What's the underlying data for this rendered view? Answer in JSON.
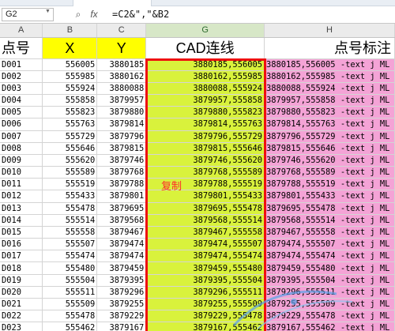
{
  "formula_bar": {
    "cell_ref": "G2",
    "fx_icon": "fx-icon",
    "formula": "=C2&\",\"&B2"
  },
  "columns": [
    "A",
    "B",
    "C",
    "G",
    "H"
  ],
  "headers": {
    "a": "点号",
    "b": "X",
    "c": "Y",
    "g": "CAD连线",
    "h": "点号标注"
  },
  "rows": [
    {
      "a": "D001",
      "b": "556005",
      "c": "3880185",
      "g": "3880185,556005",
      "h": "3880185,556005  -text j ML"
    },
    {
      "a": "D002",
      "b": "555985",
      "c": "3880162",
      "g": "3880162,555985",
      "h": "3880162,555985  -text j ML"
    },
    {
      "a": "D003",
      "b": "555924",
      "c": "3880088",
      "g": "3880088,555924",
      "h": "3880088,555924  -text j ML"
    },
    {
      "a": "D004",
      "b": "555858",
      "c": "3879957",
      "g": "3879957,555858",
      "h": "3879957,555858  -text j ML"
    },
    {
      "a": "D005",
      "b": "555823",
      "c": "3879880",
      "g": "3879880,555823",
      "h": "3879880,555823  -text j ML"
    },
    {
      "a": "D006",
      "b": "555763",
      "c": "3879814",
      "g": "3879814,555763",
      "h": "3879814,555763  -text j ML"
    },
    {
      "a": "D007",
      "b": "555729",
      "c": "3879796",
      "g": "3879796,555729",
      "h": "3879796,555729  -text j ML"
    },
    {
      "a": "D008",
      "b": "555646",
      "c": "3879815",
      "g": "3879815,555646",
      "h": "3879815,555646  -text j ML"
    },
    {
      "a": "D009",
      "b": "555620",
      "c": "3879746",
      "g": "3879746,555620",
      "h": "3879746,555620  -text j ML"
    },
    {
      "a": "D010",
      "b": "555589",
      "c": "3879768",
      "g": "3879768,555589",
      "h": "3879768,555589  -text j ML"
    },
    {
      "a": "D011",
      "b": "555519",
      "c": "3879788",
      "g": "3879788,555519",
      "h": "3879788,555519  -text j ML"
    },
    {
      "a": "D012",
      "b": "555433",
      "c": "3879801",
      "g": "3879801,555433",
      "h": "3879801,555433  -text j ML"
    },
    {
      "a": "D013",
      "b": "555478",
      "c": "3879695",
      "g": "3879695,555478",
      "h": "3879695,555478  -text j ML"
    },
    {
      "a": "D014",
      "b": "555514",
      "c": "3879568",
      "g": "3879568,555514",
      "h": "3879568,555514  -text j ML"
    },
    {
      "a": "D015",
      "b": "555558",
      "c": "3879467",
      "g": "3879467,555558",
      "h": "3879467,555558  -text j ML"
    },
    {
      "a": "D016",
      "b": "555507",
      "c": "3879474",
      "g": "3879474,555507",
      "h": "3879474,555507  -text j ML"
    },
    {
      "a": "D017",
      "b": "555474",
      "c": "3879474",
      "g": "3879474,555474",
      "h": "3879474,555474  -text j ML"
    },
    {
      "a": "D018",
      "b": "555480",
      "c": "3879459",
      "g": "3879459,555480",
      "h": "3879459,555480  -text j ML"
    },
    {
      "a": "D019",
      "b": "555504",
      "c": "3879395",
      "g": "3879395,555504",
      "h": "3879395,555504  -text j ML"
    },
    {
      "a": "D020",
      "b": "555511",
      "c": "3879296",
      "g": "3879296,555511",
      "h": "3879296,555511  -text j ML"
    },
    {
      "a": "D021",
      "b": "555509",
      "c": "3879255",
      "g": "3879255,555509",
      "h": "3879255,555509  -text j ML"
    },
    {
      "a": "D022",
      "b": "555478",
      "c": "3879229",
      "g": "3879229,555478",
      "h": "3879229,555478  -text j ML"
    },
    {
      "a": "D023",
      "b": "555462",
      "c": "3879167",
      "g": "3879167,555462",
      "h": "3879167,555462  -text j ML"
    }
  ],
  "annotation": {
    "text": "复制"
  },
  "colors": {
    "yellow_header": "#ffff00",
    "g_fill": "#d9f23c",
    "h_fill": "#f4a3d6",
    "red_outline": "#ee1010"
  }
}
